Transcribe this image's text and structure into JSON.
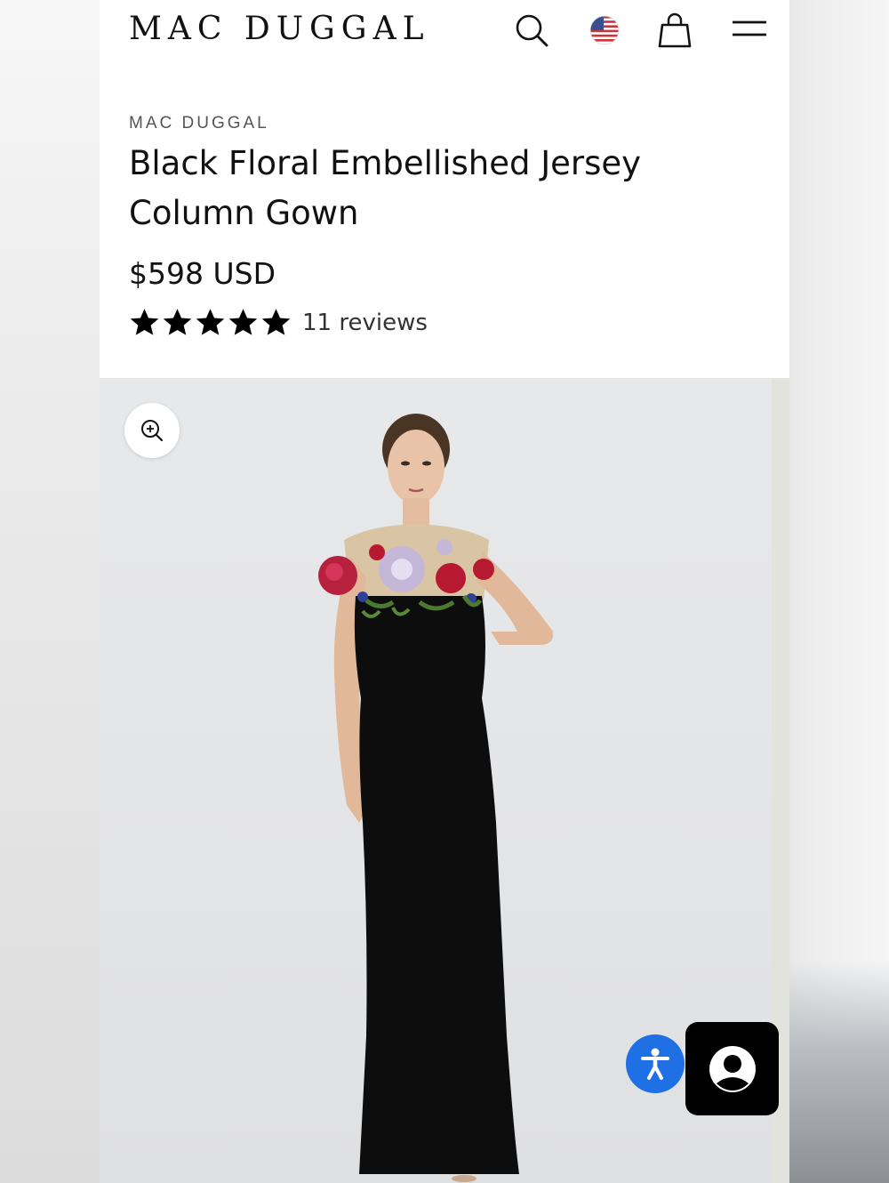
{
  "header": {
    "logo": "MAC DUGGAL",
    "icons": [
      "search-icon",
      "us-flag-icon",
      "shopping-bag-icon",
      "menu-icon"
    ]
  },
  "product": {
    "brand": "MAC DUGGAL",
    "title": "Black Floral Embellished Jersey Column Gown",
    "price": "$598 USD",
    "rating": 5,
    "rating_max": 5,
    "reviews_label": "11 reviews"
  },
  "gallery": {
    "zoom_icon": "zoom-in-icon",
    "image_subject": "model-in-black-gown-photo"
  },
  "floating": {
    "accessibility_icon": "accessibility-icon",
    "account_icon": "user-account-icon"
  },
  "colors": {
    "accessibility_blue": "#1f6fe5",
    "account_black": "#000000",
    "dress_black": "#0d0d0d"
  }
}
